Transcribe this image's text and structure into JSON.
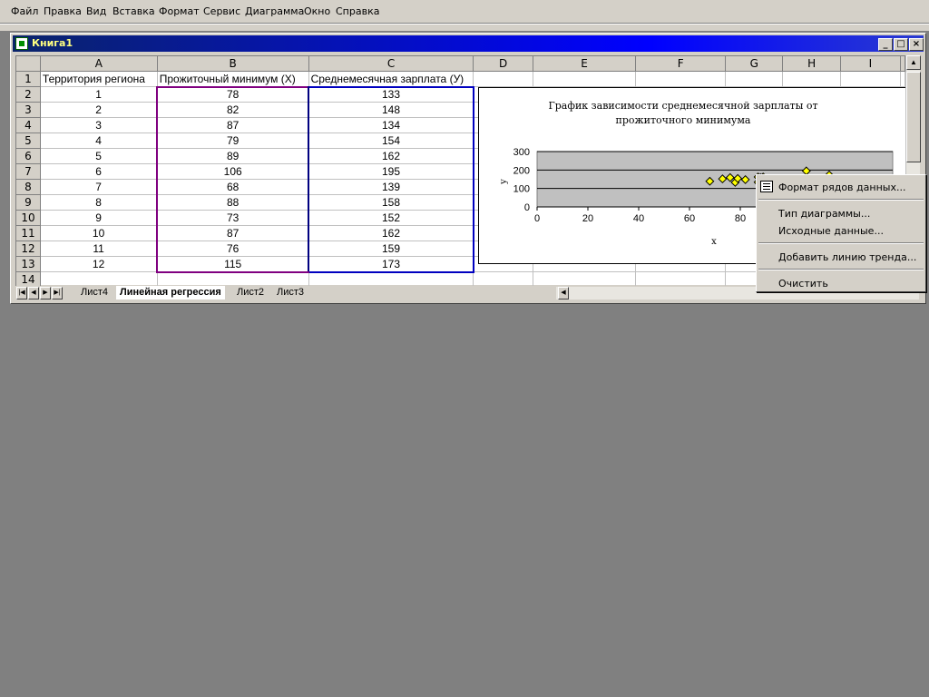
{
  "menu": [
    "Файл",
    "Правка",
    "Вид",
    "Вставка",
    "Формат",
    "Сервис",
    "Диаграмма",
    "Окно",
    "Справка"
  ],
  "window": {
    "title": "Книга1"
  },
  "columns": [
    "A",
    "B",
    "C",
    "D",
    "E",
    "F",
    "G",
    "H",
    "I"
  ],
  "headers": {
    "a": "Территория региона",
    "b": "Прожиточный минимум (X)",
    "c": "Среднемесячная зарплата (У)"
  },
  "rows": [
    {
      "n": "1"
    },
    {
      "n": "2",
      "a": "1",
      "b": "78",
      "c": "133"
    },
    {
      "n": "3",
      "a": "2",
      "b": "82",
      "c": "148"
    },
    {
      "n": "4",
      "a": "3",
      "b": "87",
      "c": "134"
    },
    {
      "n": "5",
      "a": "4",
      "b": "79",
      "c": "154"
    },
    {
      "n": "6",
      "a": "5",
      "b": "89",
      "c": "162"
    },
    {
      "n": "7",
      "a": "6",
      "b": "106",
      "c": "195"
    },
    {
      "n": "8",
      "a": "7",
      "b": "68",
      "c": "139"
    },
    {
      "n": "9",
      "a": "8",
      "b": "88",
      "c": "158"
    },
    {
      "n": "10",
      "a": "9",
      "b": "73",
      "c": "152"
    },
    {
      "n": "11",
      "a": "10",
      "b": "87",
      "c": "162"
    },
    {
      "n": "12",
      "a": "11",
      "b": "76",
      "c": "159"
    },
    {
      "n": "13",
      "a": "12",
      "b": "115",
      "c": "173"
    },
    {
      "n": "14"
    }
  ],
  "chart_data": {
    "type": "scatter",
    "title": "График зависимости среднемесячной зарплаты от прожиточного минимума",
    "xlabel": "x",
    "ylabel": "y",
    "xticks": [
      "0",
      "20",
      "40",
      "60",
      "80"
    ],
    "yticks": [
      "0",
      "100",
      "200",
      "300"
    ],
    "xlim": [
      0,
      140
    ],
    "ylim": [
      0,
      300
    ],
    "x": [
      78,
      82,
      87,
      79,
      89,
      106,
      68,
      88,
      73,
      87,
      76,
      115
    ],
    "y": [
      133,
      148,
      134,
      154,
      162,
      195,
      139,
      158,
      152,
      162,
      159,
      173
    ],
    "plot_bg": "#c0c0c0",
    "point_color": "#ffff00"
  },
  "sheet_tabs": [
    "Лист4",
    "Линейная регрессия",
    "Лист2",
    "Лист3"
  ],
  "context_menu": [
    "Формат рядов данных...",
    "Тип диаграммы...",
    "Исходные данные...",
    "Добавить линию тренда...",
    "Очистить"
  ]
}
